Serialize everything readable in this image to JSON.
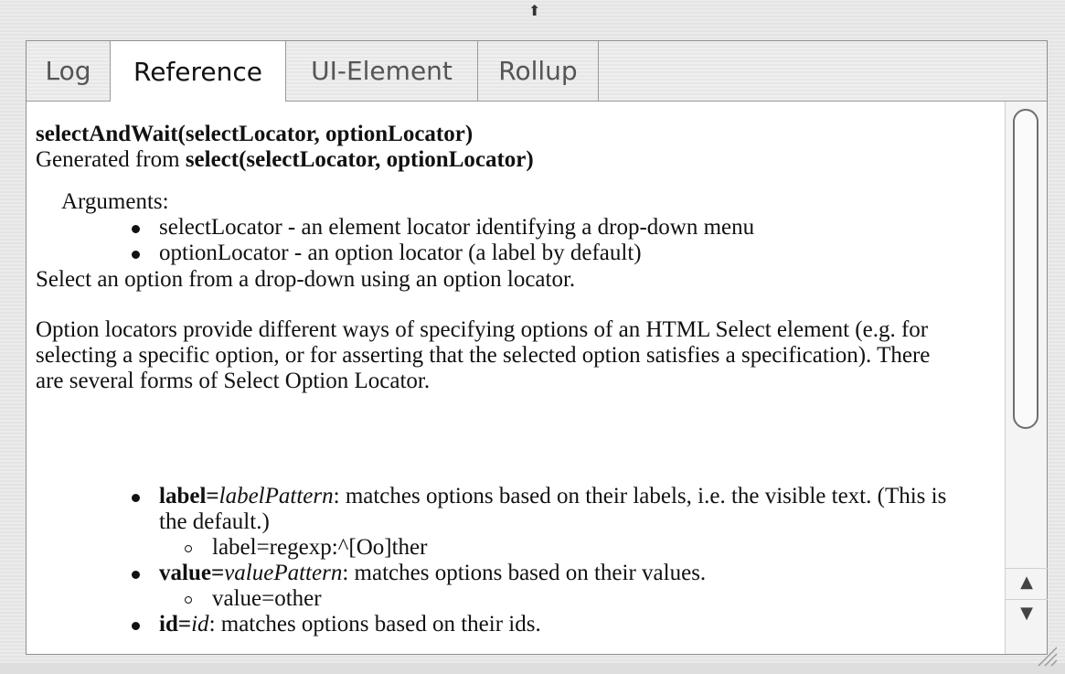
{
  "top_handle": "⬆",
  "tabs": [
    {
      "label": "Log",
      "active": false
    },
    {
      "label": "Reference",
      "active": true
    },
    {
      "label": "UI-Element",
      "active": false
    },
    {
      "label": "Rollup",
      "active": false
    }
  ],
  "reference": {
    "signature": {
      "name": "selectAndWait(",
      "params": "selectLocator, optionLocator",
      "close": ")"
    },
    "generated": {
      "prefix": "Generated from ",
      "source": "select(selectLocator, optionLocator)"
    },
    "arguments_label": "Arguments:",
    "arguments": [
      "selectLocator - an element locator identifying a drop-down menu",
      "optionLocator - an option locator (a label by default)"
    ],
    "description": "Select an option from a drop-down using an option locator.",
    "paragraph": "Option locators provide different ways of specifying options of an HTML Select element (e.g. for selecting a specific option, or for asserting that the selected option satisfies a specification). There are several forms of Select Option Locator.",
    "options": [
      {
        "key": "label=",
        "pattern": "labelPattern",
        "text": ": matches options based on their labels, i.e. the visible text. (This is the default.)",
        "example": "label=regexp:^[Oo]ther"
      },
      {
        "key": "value=",
        "pattern": "valuePattern",
        "text": ": matches options based on their values.",
        "example": "value=other"
      },
      {
        "key": "id=",
        "pattern": "id",
        "text": ": matches options based on their ids."
      }
    ]
  },
  "scrollbar": {
    "up_icon": "▲",
    "down_icon": "▼"
  }
}
